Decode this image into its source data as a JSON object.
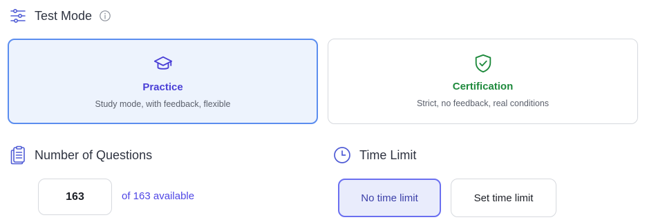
{
  "test_mode": {
    "title": "Test Mode",
    "icon": "sliders-icon",
    "info_icon": "info-icon"
  },
  "modes": [
    {
      "id": "practice",
      "title": "Practice",
      "subtitle": "Study mode, with feedback, flexible",
      "icon": "graduation-cap-icon",
      "selected": true,
      "accent": "#4a3fd6"
    },
    {
      "id": "certification",
      "title": "Certification",
      "subtitle": "Strict, no feedback, real conditions",
      "icon": "shield-check-icon",
      "selected": false,
      "accent": "#1f8a3d"
    }
  ],
  "questions": {
    "title": "Number of Questions",
    "icon": "clipboard-list-icon",
    "value": "163",
    "available_text": "of 163 available"
  },
  "time_limit": {
    "title": "Time Limit",
    "icon": "clock-icon",
    "options": [
      {
        "label": "No time limit",
        "selected": true
      },
      {
        "label": "Set time limit",
        "selected": false
      }
    ]
  },
  "colors": {
    "primary": "#5b8def",
    "practice_bg": "#edf3fd",
    "selected_button_bg": "#e9ecfc",
    "link": "#4f46e5",
    "border": "#d6d9de"
  }
}
